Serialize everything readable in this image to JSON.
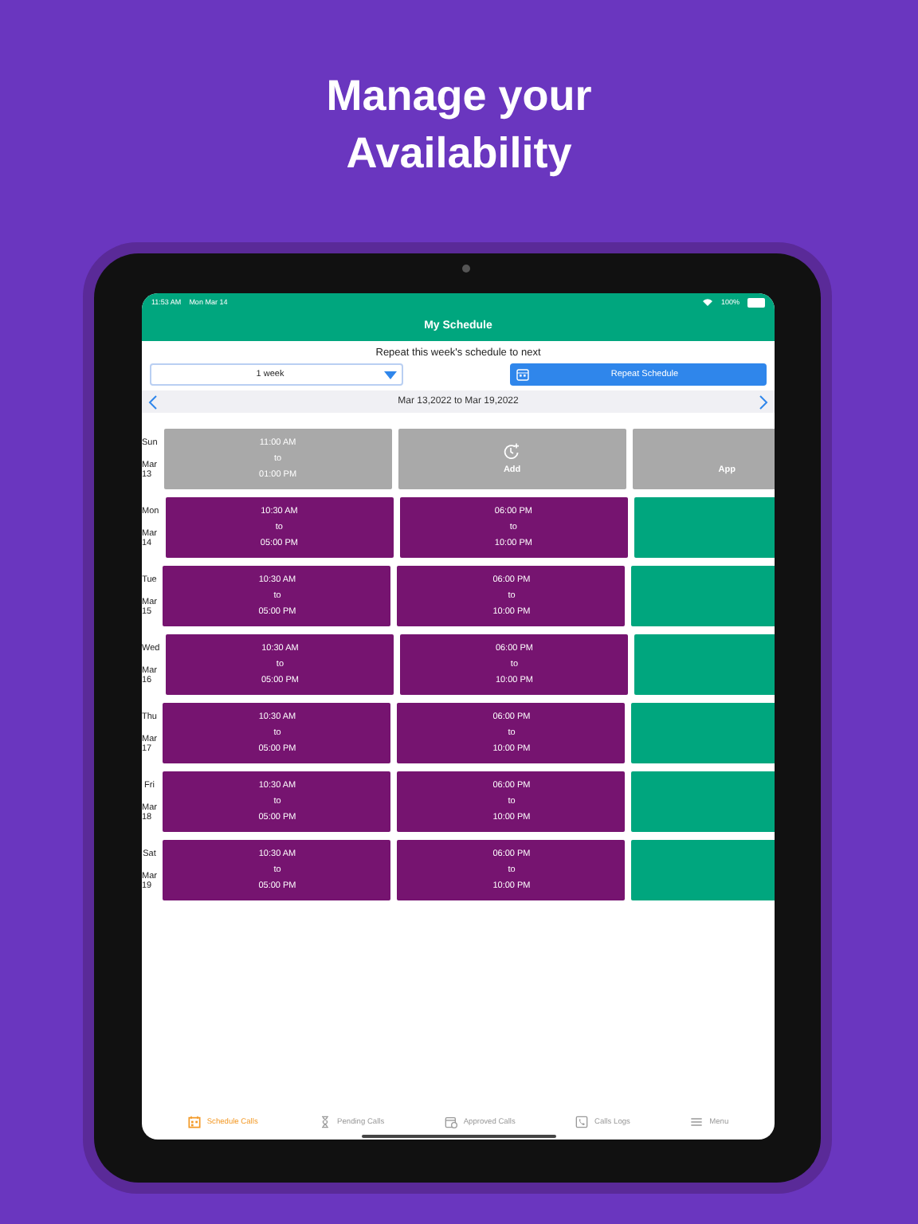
{
  "headline": [
    "Manage your",
    "Availability"
  ],
  "status_bar": {
    "time": "11:53 AM",
    "date": "Mon Mar 14",
    "battery": "100%"
  },
  "header": {
    "title": "My Schedule"
  },
  "repeat": {
    "prompt": "Repeat this week's schedule to next",
    "period": "1 week",
    "button": "Repeat Schedule"
  },
  "week": {
    "range": "Mar 13,2022 to Mar 19,2022"
  },
  "rows": [
    {
      "day": "Sun",
      "date": "Mar 13",
      "slots": [
        {
          "kind": "past",
          "start": "11:00 AM",
          "sep": "to",
          "end": "01:00 PM"
        },
        {
          "kind": "add",
          "label": "Add"
        },
        {
          "kind": "past-cut",
          "label": "App"
        }
      ]
    },
    {
      "day": "Mon",
      "date": "Mar 14",
      "slots": [
        {
          "kind": "booked",
          "start": "10:30 AM",
          "sep": "to",
          "end": "05:00 PM"
        },
        {
          "kind": "booked",
          "start": "06:00 PM",
          "sep": "to",
          "end": "10:00 PM"
        },
        {
          "kind": "open"
        }
      ]
    },
    {
      "day": "Tue",
      "date": "Mar 15",
      "slots": [
        {
          "kind": "booked",
          "start": "10:30 AM",
          "sep": "to",
          "end": "05:00 PM"
        },
        {
          "kind": "booked",
          "start": "06:00 PM",
          "sep": "to",
          "end": "10:00 PM"
        },
        {
          "kind": "open"
        }
      ]
    },
    {
      "day": "Wed",
      "date": "Mar 16",
      "slots": [
        {
          "kind": "booked",
          "start": "10:30 AM",
          "sep": "to",
          "end": "05:00 PM"
        },
        {
          "kind": "booked",
          "start": "06:00 PM",
          "sep": "to",
          "end": "10:00 PM"
        },
        {
          "kind": "open"
        }
      ]
    },
    {
      "day": "Thu",
      "date": "Mar 17",
      "slots": [
        {
          "kind": "booked",
          "start": "10:30 AM",
          "sep": "to",
          "end": "05:00 PM"
        },
        {
          "kind": "booked",
          "start": "06:00 PM",
          "sep": "to",
          "end": "10:00 PM"
        },
        {
          "kind": "open"
        }
      ]
    },
    {
      "day": "Fri",
      "date": "Mar 18",
      "slots": [
        {
          "kind": "booked",
          "start": "10:30 AM",
          "sep": "to",
          "end": "05:00 PM"
        },
        {
          "kind": "booked",
          "start": "06:00 PM",
          "sep": "to",
          "end": "10:00 PM"
        },
        {
          "kind": "open"
        }
      ]
    },
    {
      "day": "Sat",
      "date": "Mar 19",
      "slots": [
        {
          "kind": "booked",
          "start": "10:30 AM",
          "sep": "to",
          "end": "05:00 PM"
        },
        {
          "kind": "booked",
          "start": "06:00 PM",
          "sep": "to",
          "end": "10:00 PM"
        },
        {
          "kind": "open"
        }
      ]
    }
  ],
  "tabs": [
    {
      "label": "Schedule Calls",
      "selected": true
    },
    {
      "label": "Pending Calls",
      "selected": false
    },
    {
      "label": "Approved Calls",
      "selected": false
    },
    {
      "label": "Calls Logs",
      "selected": false
    },
    {
      "label": "Menu",
      "selected": false
    }
  ]
}
